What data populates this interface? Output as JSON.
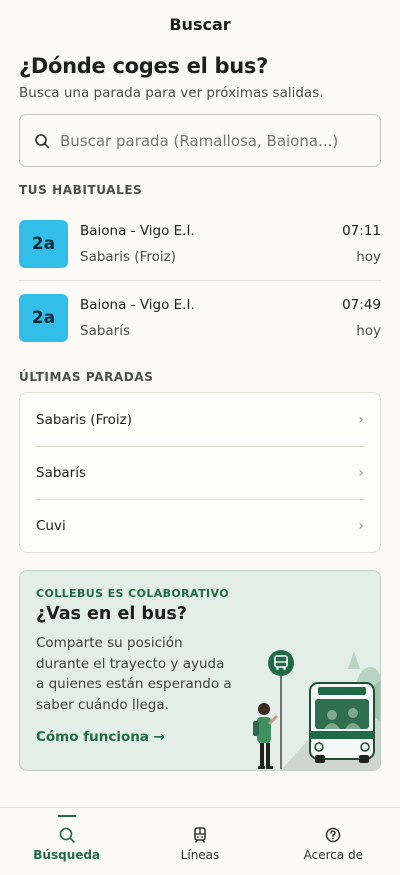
{
  "header": {
    "title": "Buscar"
  },
  "hero": {
    "title": "¿Dónde coges el bus?",
    "subtitle": "Busca una parada para ver próximas salidas."
  },
  "search": {
    "placeholder": "Buscar parada (Ramallosa, Baiona...)",
    "value": ""
  },
  "favorites": {
    "title": "TUS HABITUALES",
    "items": [
      {
        "line": "2a",
        "route": "Baiona - Vigo E.I.",
        "stop": "Sabaris (Froiz)",
        "time": "07:11",
        "day": "hoy"
      },
      {
        "line": "2a",
        "route": "Baiona - Vigo E.I.",
        "stop": "Sabarís",
        "time": "07:49",
        "day": "hoy"
      }
    ]
  },
  "recent": {
    "title": "ÚLTIMAS PARADAS",
    "items": [
      {
        "label": "Sabaris (Froiz)"
      },
      {
        "label": "Sabarís"
      },
      {
        "label": "Cuvi"
      }
    ]
  },
  "promo": {
    "eyebrow": "COLLEBUS ES COLABORATIVO",
    "title": "¿Vas en el bus?",
    "body": "Comparte su posición durante el trayecto y ayuda a quienes están esperando a saber cuándo llega.",
    "link": "Cómo funciona →"
  },
  "tabs": [
    {
      "label": "Búsqueda",
      "icon": "search-icon",
      "active": true
    },
    {
      "label": "Líneas",
      "icon": "train-icon",
      "active": false
    },
    {
      "label": "Acerca de",
      "icon": "help-icon",
      "active": false
    }
  ],
  "colors": {
    "accent": "#1f6b48",
    "line_badge": "#33bde9"
  }
}
